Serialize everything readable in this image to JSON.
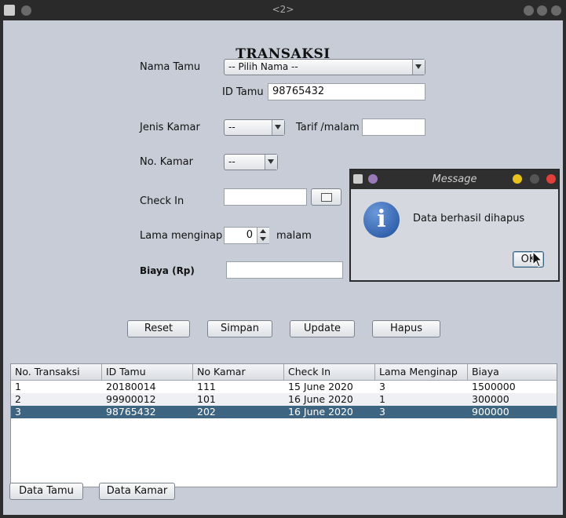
{
  "window": {
    "title": "<2>"
  },
  "heading": "TRANSAKSI",
  "form": {
    "nama_tamu_label": "Nama Tamu",
    "nama_tamu_value": "-- Pilih Nama --",
    "id_tamu_label": "ID Tamu",
    "id_tamu_value": "98765432",
    "jenis_kamar_label": "Jenis Kamar",
    "jenis_kamar_value": "--",
    "tarif_label": "Tarif /malam",
    "tarif_value": "",
    "no_kamar_label": "No. Kamar",
    "no_kamar_value": "--",
    "check_in_label": "Check In",
    "check_in_value": "",
    "lama_label": "Lama menginap",
    "lama_value": "0",
    "malam_label": "malam",
    "biaya_label": "Biaya (Rp)",
    "biaya_value": ""
  },
  "buttons": {
    "reset": "Reset",
    "simpan": "Simpan",
    "update": "Update",
    "hapus": "Hapus",
    "data_tamu": "Data Tamu",
    "data_kamar": "Data Kamar"
  },
  "table": {
    "headers": [
      "No. Transaksi",
      "ID Tamu",
      "No Kamar",
      "Check In",
      "Lama Menginap",
      "Biaya"
    ],
    "rows": [
      [
        "1",
        "20180014",
        "111",
        "15 June 2020",
        "3",
        "1500000"
      ],
      [
        "2",
        "99900012",
        "101",
        "16 June 2020",
        "1",
        "300000"
      ],
      [
        "3",
        "98765432",
        "202",
        "16 June 2020",
        "3",
        "900000"
      ]
    ],
    "selected_row": 3
  },
  "dialog": {
    "title": "Message",
    "message": "Data berhasil dihapus",
    "ok": "OK"
  },
  "colors": {
    "selected_row": "#3d6480",
    "frame_bg": "#c7ccd6",
    "titlebar_bg": "#2a2a2a"
  }
}
